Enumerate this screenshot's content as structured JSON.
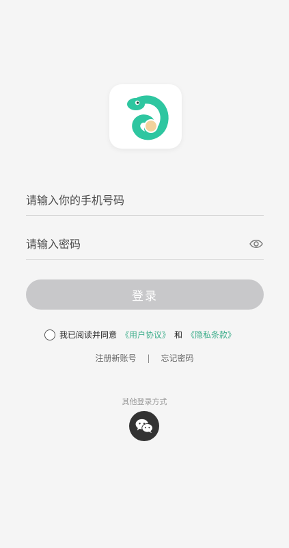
{
  "form": {
    "phone_placeholder": "请输入你的手机号码",
    "password_placeholder": "请输入密码",
    "login_label": "登录"
  },
  "agreement": {
    "prefix": "我已阅读并同意",
    "user_agreement": "《用户协议》",
    "conjunction": "和",
    "privacy_policy": "《隐私条款》"
  },
  "links": {
    "register": "注册新账号",
    "separator": "|",
    "forgot_password": "忘记密码"
  },
  "other_login": {
    "title": "其他登录方式",
    "icon": "wechat-icon"
  },
  "colors": {
    "accent": "#3fae8c",
    "button_disabled": "#c8c8ca",
    "logo_green": "#2ec6a0"
  }
}
